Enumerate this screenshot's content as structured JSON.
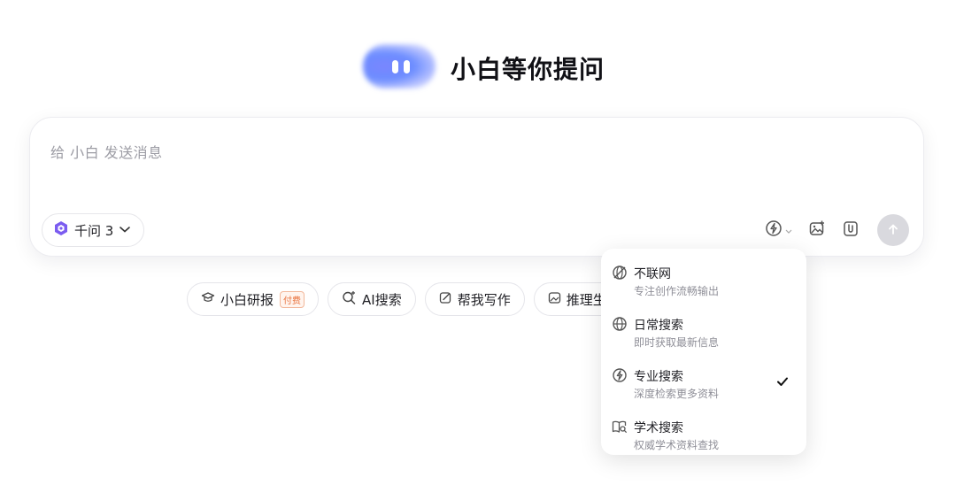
{
  "hero": {
    "title": "小白等你提问"
  },
  "composer": {
    "placeholder": "给 小白 发送消息",
    "model_label": "千问 3"
  },
  "chips": [
    {
      "label": "小白研报",
      "badge": "付费"
    },
    {
      "label": "AI搜索"
    },
    {
      "label": "帮我写作"
    },
    {
      "label": "推理生"
    }
  ],
  "search_menu": {
    "options": [
      {
        "title": "不联网",
        "desc": "专注创作流畅输出",
        "icon": "no-network-icon",
        "selected": false
      },
      {
        "title": "日常搜索",
        "desc": "即时获取最新信息",
        "icon": "globe-icon",
        "selected": false
      },
      {
        "title": "专业搜索",
        "desc": "深度检索更多资料",
        "icon": "lightning-icon",
        "selected": true
      },
      {
        "title": "学术搜索",
        "desc": "权威学术资料查找",
        "icon": "book-search-icon",
        "selected": false
      }
    ]
  },
  "colors": {
    "accent": "#6b8cff",
    "badge": "#e8703b",
    "send_disabled": "#d9d9de"
  }
}
